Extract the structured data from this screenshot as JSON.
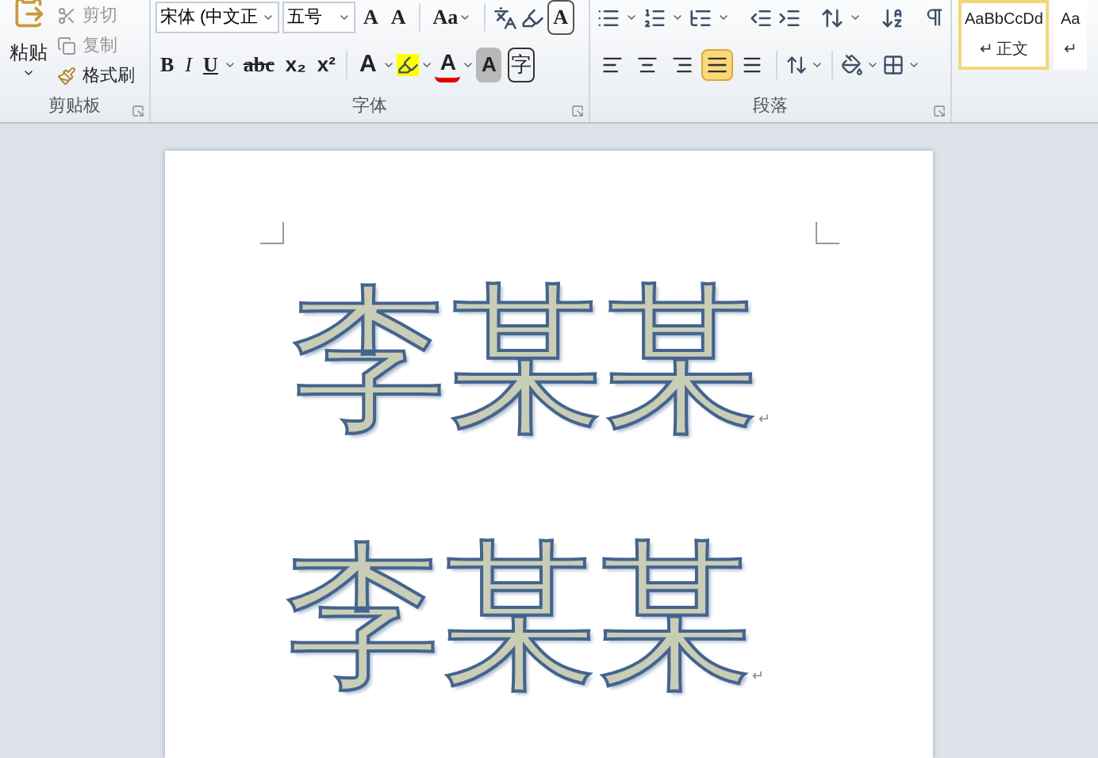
{
  "ribbon": {
    "clipboard": {
      "label": "剪贴板",
      "paste": "粘贴",
      "cut": "剪切",
      "copy": "复制",
      "format_painter": "格式刷"
    },
    "font": {
      "label": "字体",
      "font_name": "宋体 (中文正",
      "font_size": "五号",
      "grow": "A",
      "shrink": "A",
      "change_case": "Aa",
      "border_char": "A",
      "bold": "B",
      "italic": "I",
      "underline": "U",
      "strikethrough": "abc",
      "subscript": "x₂",
      "superscript": "x²",
      "text_effect": "A",
      "font_color": "A",
      "char_shading": "A",
      "enclose": "字"
    },
    "paragraph": {
      "label": "段落",
      "alignments": [
        {
          "kind": "left",
          "selected": false
        },
        {
          "kind": "center",
          "selected": false
        },
        {
          "kind": "right",
          "selected": false
        },
        {
          "kind": "justify",
          "selected": true
        },
        {
          "kind": "distributed",
          "selected": false
        }
      ]
    },
    "styles": [
      {
        "preview": "AaBbCcDd",
        "mark": "↵",
        "name": "正文",
        "selected": true
      },
      {
        "preview": "Aa",
        "mark": "↵",
        "selected": false
      }
    ]
  },
  "document": {
    "lines": [
      {
        "text": "李某某",
        "end_mark": "↵"
      },
      {
        "text": "李某某",
        "end_mark": "↵"
      }
    ]
  }
}
